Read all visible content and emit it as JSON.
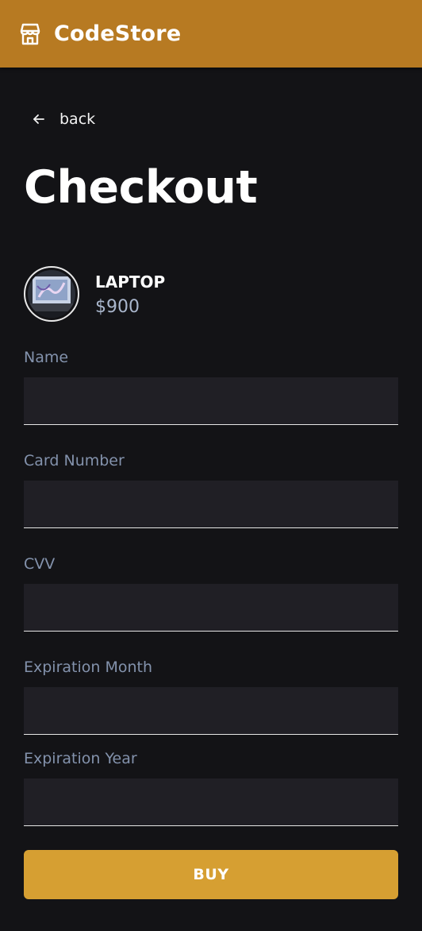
{
  "header": {
    "brand": "CodeStore",
    "logo_icon": "storefront-icon",
    "background": "#b77a22"
  },
  "nav": {
    "back_label": "back",
    "back_icon": "arrow-left-icon"
  },
  "page": {
    "title": "Checkout"
  },
  "product": {
    "name": "LAPTOP",
    "price": "$900",
    "image_icon": "laptop-photo-thumbnail"
  },
  "form": {
    "fields": [
      {
        "label": "Name",
        "value": ""
      },
      {
        "label": "Card Number",
        "value": ""
      },
      {
        "label": "CVV",
        "value": ""
      },
      {
        "label": "Expiration Month",
        "value": ""
      },
      {
        "label": "Expiration Year",
        "value": ""
      }
    ],
    "submit_label": "BUY",
    "submit_color": "#d69f32"
  }
}
